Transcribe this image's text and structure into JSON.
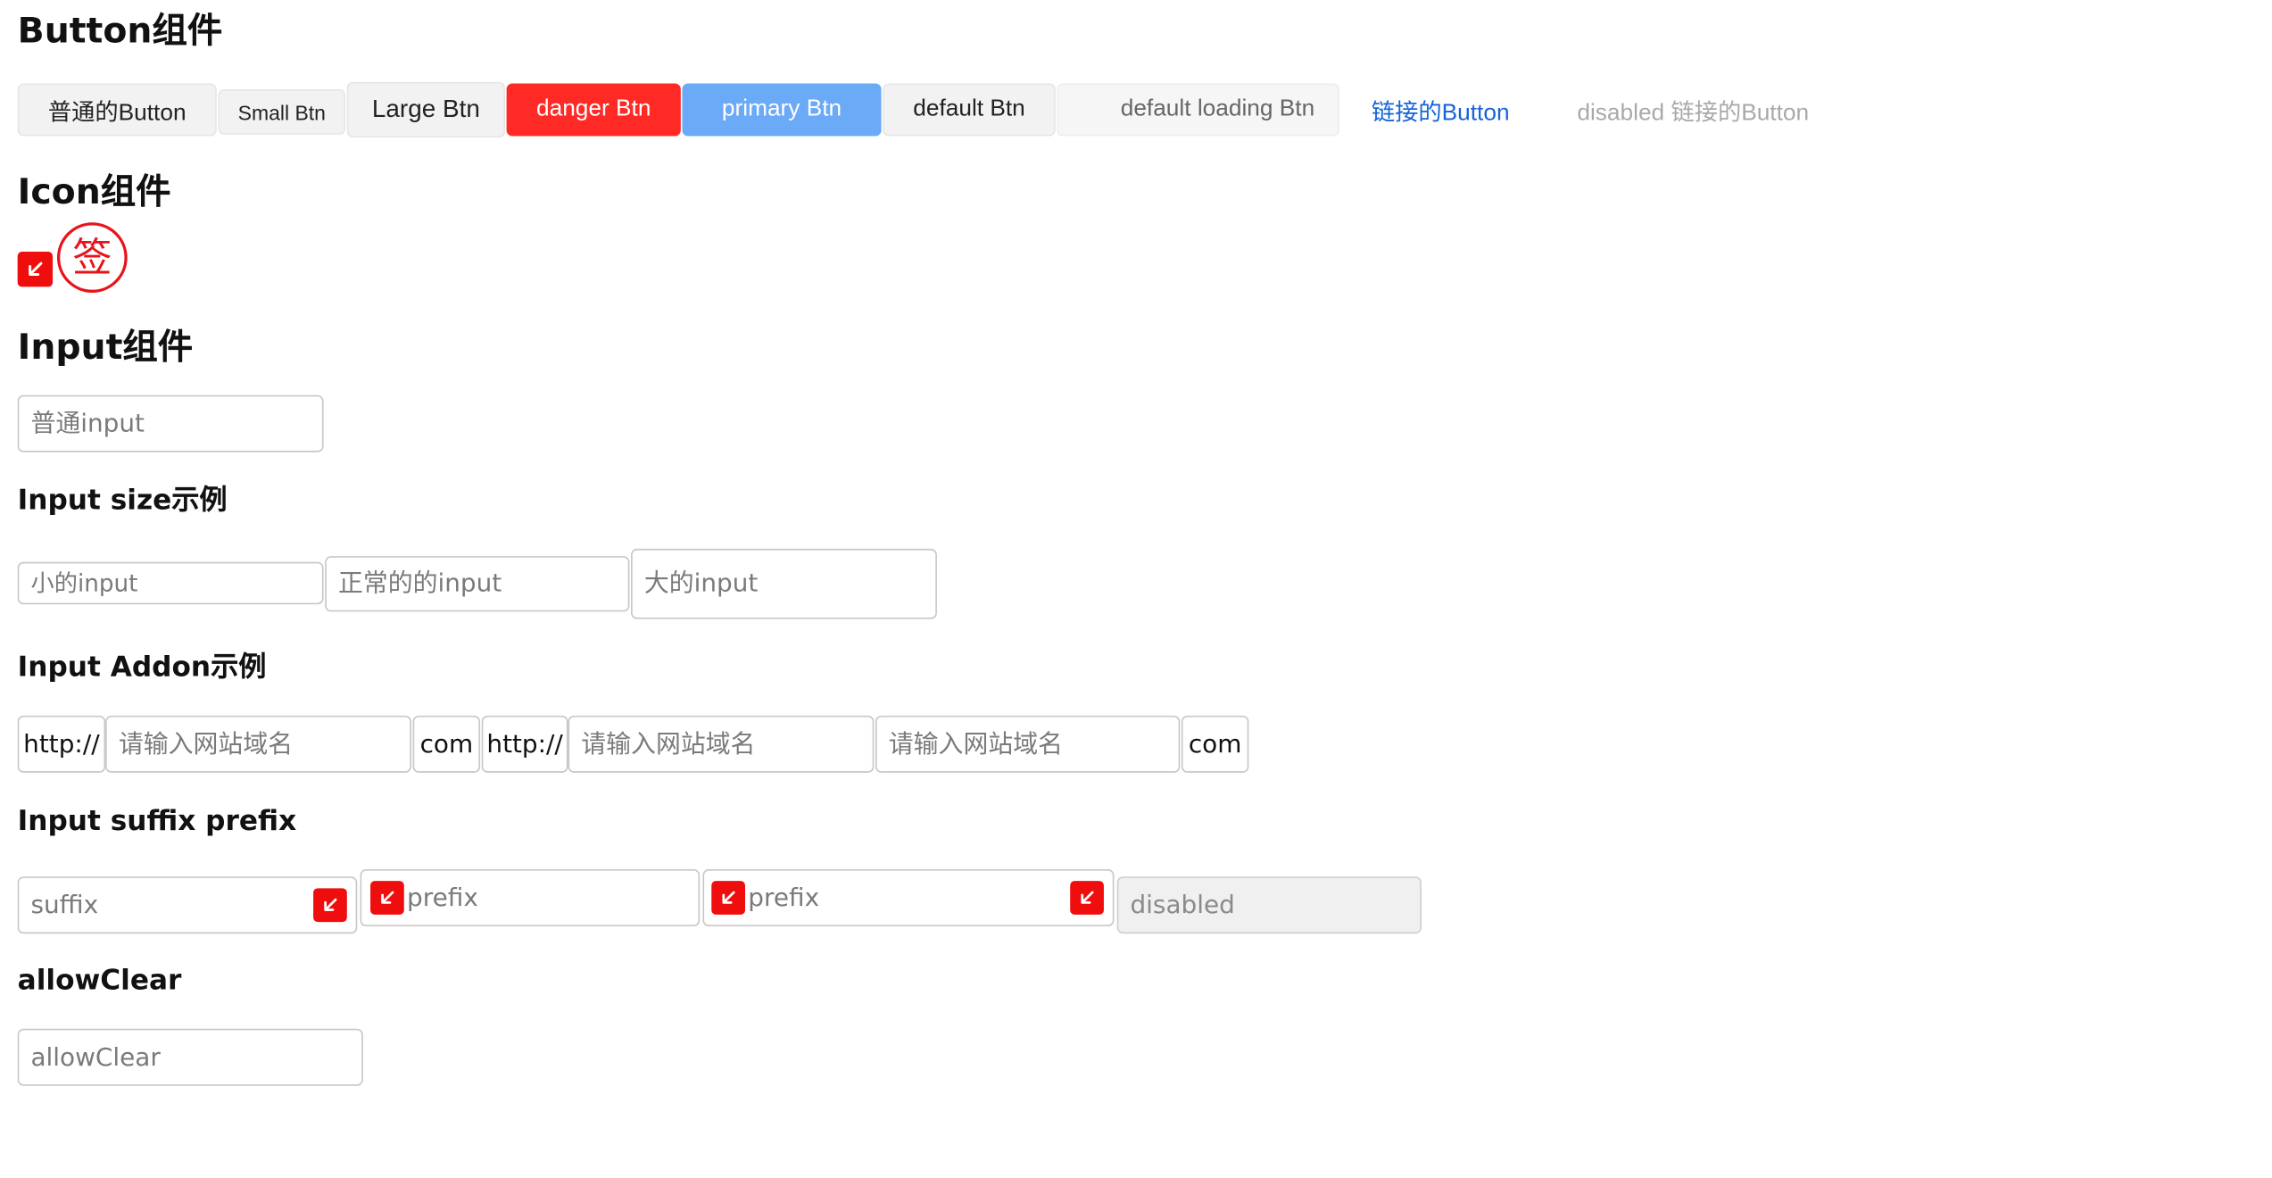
{
  "sections": {
    "button_title": "Button组件",
    "icon_title": "Icon组件",
    "input_title": "Input组件",
    "input_size_title": "Input size示例",
    "input_addon_title": "Input Addon示例",
    "input_suffix_prefix_title": "Input suffix prefix",
    "allow_clear_title": "allowClear"
  },
  "buttons": {
    "normal": "普通的Button",
    "small": "Small Btn",
    "large": "Large Btn",
    "danger": "danger Btn",
    "primary": "primary Btn",
    "default": "default Btn",
    "default_loading": "default loading Btn",
    "link": "链接的Button",
    "disabled_link": "disabled 链接的Button"
  },
  "icons": {
    "arrow_icon": "arrow-down-left-icon",
    "seal_icon": "seal-icon",
    "seal_text": "签"
  },
  "inputs": {
    "normal_placeholder": "普通input",
    "size_small_placeholder": "小的input",
    "size_normal_placeholder": "正常的的input",
    "size_large_placeholder": "大的input"
  },
  "addon": {
    "prefix": "http://",
    "suffix": "com",
    "placeholder": "请输入网站域名"
  },
  "suffix_prefix": {
    "suffix_placeholder": "suffix",
    "prefix_placeholder": "prefix",
    "both_placeholder": "prefix",
    "disabled_placeholder": "disabled"
  },
  "allow_clear": {
    "placeholder": "allowClear"
  },
  "colors": {
    "danger": "#ff2a25",
    "primary": "#6aaaf7",
    "link": "#1663d8",
    "icon_red": "#f00d0d"
  }
}
